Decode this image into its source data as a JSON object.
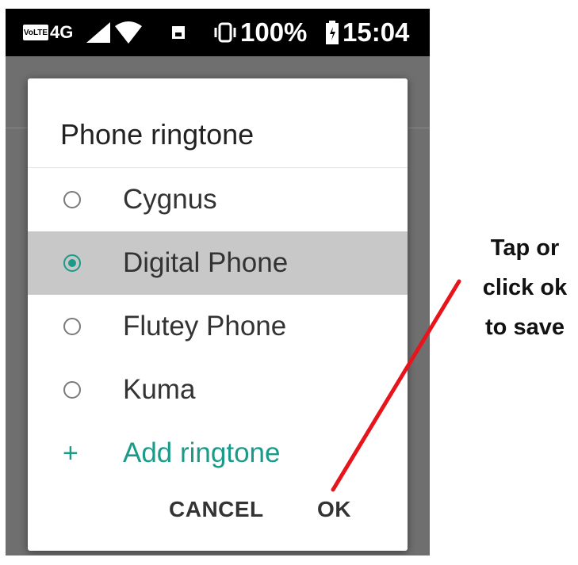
{
  "status_bar": {
    "volte": "VoLTE",
    "network": "4G",
    "battery_percent": "100%",
    "time": "15:04",
    "icons": [
      "signal-icon",
      "wifi-icon",
      "sim-icon",
      "vibrate-icon",
      "battery-icon"
    ]
  },
  "dialog": {
    "title": "Phone ringtone",
    "options": [
      {
        "label": "Cygnus",
        "selected": false
      },
      {
        "label": "Digital Phone",
        "selected": true
      },
      {
        "label": "Flutey Phone",
        "selected": false
      },
      {
        "label": "Kuma",
        "selected": false
      }
    ],
    "add_label": "Add ringtone",
    "add_icon": "+",
    "cancel_label": "CANCEL",
    "ok_label": "OK"
  },
  "annotation": {
    "lines": [
      "Tap or",
      "click ok",
      "to save"
    ],
    "arrow_color": "#e8141c"
  },
  "colors": {
    "accent": "#1a9b8a",
    "selected_row": "#c8c8c8"
  }
}
